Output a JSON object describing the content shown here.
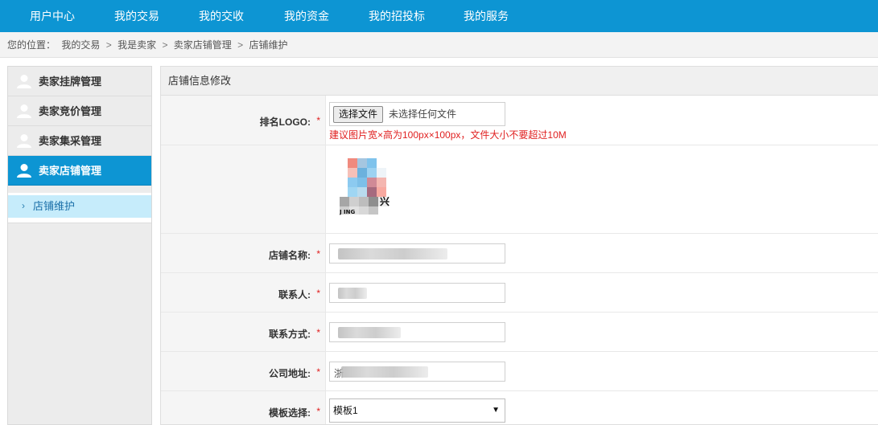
{
  "topnav": {
    "items": [
      "用户中心",
      "我的交易",
      "我的交收",
      "我的资金",
      "我的招投标",
      "我的服务"
    ]
  },
  "breadcrumb": {
    "prefix": "您的位置：",
    "items": [
      "我的交易",
      "我是卖家",
      "卖家店铺管理",
      "店铺维护"
    ],
    "separator": ">"
  },
  "sidebar": {
    "items": [
      {
        "label": "卖家挂牌管理",
        "icon": "user-icon",
        "active": false
      },
      {
        "label": "卖家竞价管理",
        "icon": "user-icon",
        "active": false
      },
      {
        "label": "卖家集采管理",
        "icon": "user-icon",
        "active": false
      },
      {
        "label": "卖家店铺管理",
        "icon": "user-icon",
        "active": true
      }
    ],
    "submenu": {
      "chevron": "›",
      "label": "店铺维护"
    }
  },
  "panel": {
    "title": "店铺信息修改",
    "required_mark": "*",
    "logo": {
      "label": "排名LOGO:",
      "button": "选择文件",
      "status": "未选择任何文件",
      "hint": "建议图片宽×高为100px×100px，文件大小不要超过10M",
      "image_text": "兴",
      "image_subtext": "J        ING"
    },
    "fields": [
      {
        "label": "店铺名称:"
      },
      {
        "label": "联系人:"
      },
      {
        "label": "联系方式:"
      },
      {
        "label": "公司地址:",
        "value_hint": "浙"
      }
    ],
    "template": {
      "label": "模板选择:",
      "value": "模板1",
      "arrow": "▼"
    }
  },
  "colors": {
    "nav_blue": "#0d95d3",
    "required_red": "#e02020",
    "submenu_bg": "#c6ecfb"
  }
}
